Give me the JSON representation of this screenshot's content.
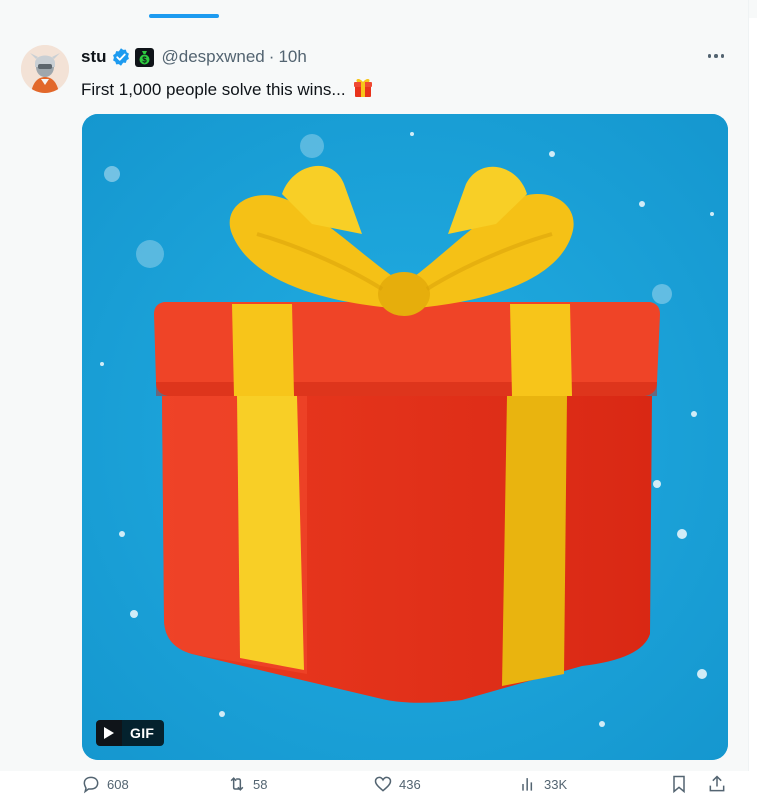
{
  "post": {
    "author_name": "stu",
    "handle": "@despxwned",
    "separator": "·",
    "timestamp": "10h",
    "text": "First 1,000 people solve this wins...",
    "text_emoji_icon": "wrapped-gift-icon",
    "media": {
      "type": "gif",
      "badge_label": "GIF",
      "background_color": "#1aa0d8"
    },
    "actions": [
      {
        "name": "reply",
        "icon": "reply-icon",
        "count": "608"
      },
      {
        "name": "repost",
        "icon": "repost-icon",
        "count": "58"
      },
      {
        "name": "like",
        "icon": "like-icon",
        "count": "436"
      },
      {
        "name": "views",
        "icon": "views-icon",
        "count": "33K"
      },
      {
        "name": "bookmark",
        "icon": "bookmark-icon",
        "count": ""
      },
      {
        "name": "share",
        "icon": "share-icon",
        "count": ""
      }
    ]
  },
  "colors": {
    "accent": "#1d9bf0",
    "text_primary": "#0f1419",
    "text_secondary": "#536471",
    "gift_red": "#e8331c",
    "ribbon_yellow": "#f7c51a"
  }
}
